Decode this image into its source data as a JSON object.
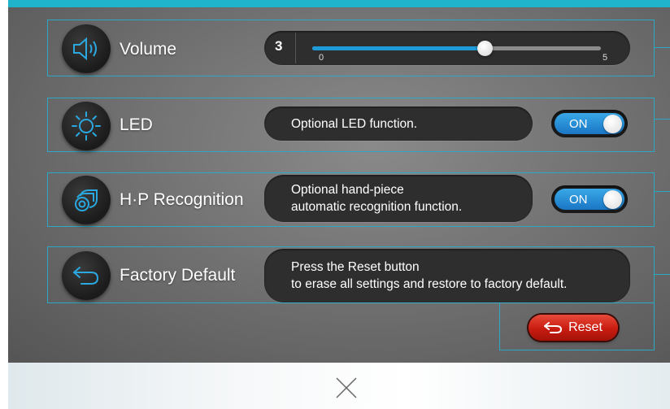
{
  "rows": {
    "volume": {
      "label": "Volume",
      "icon": "speaker-icon",
      "value": "3",
      "min_label": "0",
      "max_label": "5",
      "level": 3,
      "max": 5
    },
    "led": {
      "label": "LED",
      "icon": "sun-icon",
      "description": "Optional LED function.",
      "toggle_label": "ON"
    },
    "hp": {
      "label": "H·P Recognition",
      "icon": "handpiece-icon",
      "description_line1": "Optional hand-piece",
      "description_line2": "automatic recognition function.",
      "toggle_label": "ON"
    },
    "factory": {
      "label": "Factory Default",
      "icon": "return-arrow-icon",
      "description_line1": "Press the Reset button",
      "description_line2": "to erase all settings and restore to factory default.",
      "reset_label": "Reset"
    }
  },
  "footer": {
    "close_icon": "close-icon"
  },
  "colors": {
    "accent": "#1fb4cc",
    "toggle_on": "#1e8ad6",
    "reset": "#c81c10"
  }
}
